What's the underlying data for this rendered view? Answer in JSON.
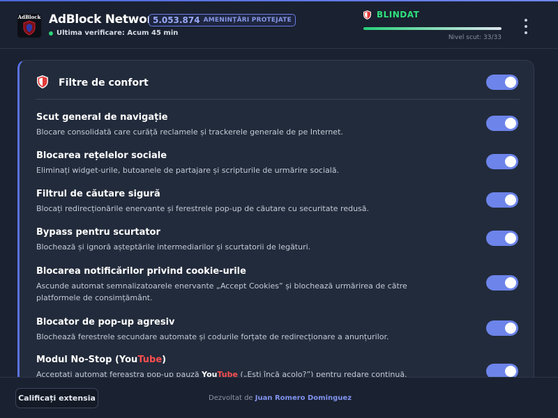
{
  "header": {
    "logo_text": "AdBlock",
    "app_title": "AdBlock Network",
    "threat_count": "5.053.874",
    "threat_label": "AMENINȚĂRI PROTEJATE",
    "last_check": "Ultima verificare: Acum 45 min",
    "status": "BLINDAT",
    "shield_level_label": "Nivel scut: 33/33",
    "shield_level": 1.0
  },
  "card": {
    "title": "Filtre de confort",
    "master_enabled": true,
    "filters": [
      {
        "title": "Scut general de navigație",
        "description": "Blocare consolidată care curăță reclamele și trackerele generale de pe Internet.",
        "enabled": true
      },
      {
        "title": "Blocarea rețelelor sociale",
        "description": "Eliminați widget-urile, butoanele de partajare și scripturile de urmărire socială.",
        "enabled": true
      },
      {
        "title": "Filtrul de căutare sigură",
        "description": "Blocați redirecționările enervante și ferestrele pop-up de căutare cu securitate redusă.",
        "enabled": true
      },
      {
        "title": "Bypass pentru scurtator",
        "description": "Blochează și ignoră așteptările intermediarilor și scurtatorii de legături.",
        "enabled": true
      },
      {
        "title": "Blocarea notificărilor privind cookie-urile",
        "description": "Ascunde automat semnalizatoarele enervante „Accept Cookies” și blochează urmărirea de către platformele de consimțământ.",
        "enabled": true
      },
      {
        "title": "Blocator de pop-up agresiv",
        "description": "Blochează ferestrele secundare automate și codurile forțate de redirecționare a anunțurilor.",
        "enabled": true
      }
    ],
    "youtube_filter": {
      "title_a": "Modul No-Stop (",
      "yt_you": "You",
      "yt_tube": "Tube",
      "title_b": ")",
      "desc_a": "Acceptați automat fereastra pop-up pauză ",
      "desc_b": " („Ești încă acolo?”) pentru redare continuă.",
      "enabled": true
    }
  },
  "footer": {
    "rate_button": "Calificați extensia",
    "dev_prefix": "Dezvoltat de",
    "dev_name": "Juan Romero Dominguez"
  },
  "colors": {
    "accent": "#6d84ea",
    "status_green": "#2ee07d",
    "youtube_red": "#ff4f4f",
    "background": "#1a2130",
    "card": "#222b3b"
  }
}
